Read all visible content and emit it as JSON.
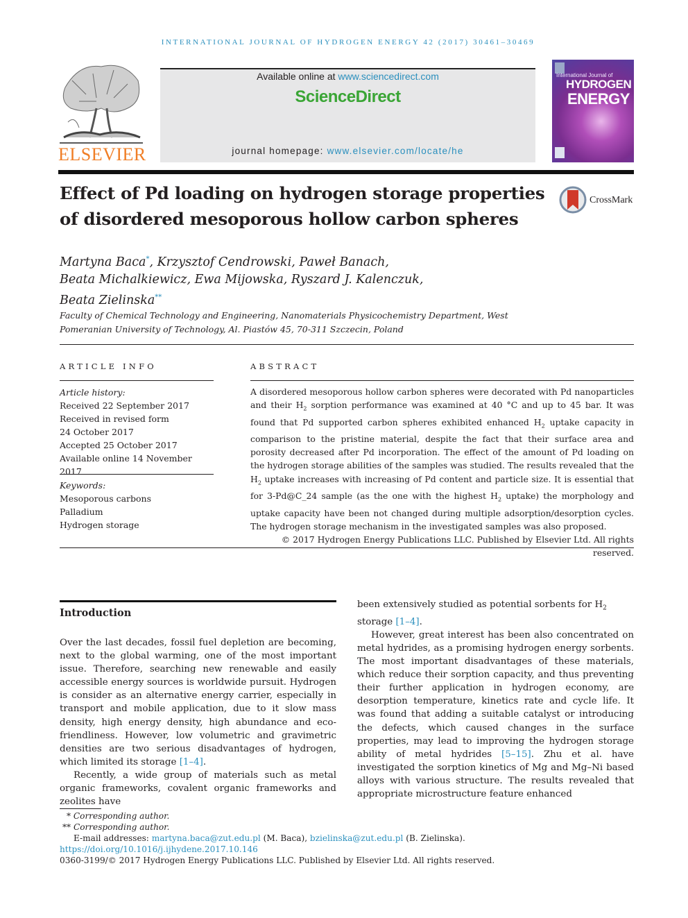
{
  "journal": {
    "running_head": "INTERNATIONAL JOURNAL OF HYDROGEN ENERGY 42 (2017) 30461–30469",
    "publisher_logo": "ELSEVIER",
    "available_prefix": "Available online at ",
    "available_link": "www.sciencedirect.com",
    "brand": "ScienceDirect",
    "homepage_prefix": "journal homepage: ",
    "homepage_link": "www.elsevier.com/locate/he",
    "cover": {
      "line1": "International Journal of",
      "line2": "HYDROGEN",
      "line3": "ENERGY"
    }
  },
  "article": {
    "title": "Effect of Pd loading on hydrogen storage properties of disordered mesoporous hollow carbon spheres",
    "crossmark_label": "CrossMark",
    "authors_line1_a": "Martyna Baca",
    "authors_line1_sup": "*",
    "authors_line1_b": ", Krzysztof Cendrowski, Paweł Banach,",
    "authors_line2": "Beata Michalkiewicz, Ewa Mijowska, Ryszard J. Kalenczuk,",
    "authors_line3_a": "Beata Zielinska",
    "authors_line3_sup": "**",
    "affiliation": "Faculty of Chemical Technology and Engineering, Nanomaterials Physicochemistry Department, West Pomeranian University of Technology, Al. Piastów 45, 70-311 Szczecin, Poland"
  },
  "article_info": {
    "heading": "ARTICLE INFO",
    "history_label": "Article history:",
    "history": [
      "Received 22 September 2017",
      "Received in revised form",
      "24 October 2017",
      "Accepted 25 October 2017",
      "Available online 14 November 2017"
    ],
    "keywords_label": "Keywords:",
    "keywords": [
      "Mesoporous carbons",
      "Palladium",
      "Hydrogen storage"
    ]
  },
  "abstract": {
    "heading": "ABSTRACT",
    "p1": "A disordered mesoporous hollow carbon spheres were decorated with Pd nanoparticles and their H",
    "p2": " sorption performance was examined at 40 °C and up to 45 bar. It was found that Pd supported carbon spheres exhibited enhanced H",
    "p3": " uptake capacity in comparison to the pristine material, despite the fact that their surface area and porosity decreased after Pd incorporation. The effect of the amount of Pd loading on the hydrogen storage abilities of the samples was studied. The results revealed that the H",
    "p4": " uptake increases with increasing of Pd content and particle size. It is essential that for 3-Pd@C_24 sample (as the one with the highest H",
    "p5": " uptake) the morphology and uptake capacity have been not changed during multiple adsorption/desorption cycles. The hydrogen storage mechanism in the investigated samples was also proposed.",
    "sub": "2",
    "copyright": "© 2017 Hydrogen Energy Publications LLC. Published by Elsevier Ltd. All rights reserved."
  },
  "body": {
    "intro_heading": "Introduction",
    "left_p1_a": "Over the last decades, fossil fuel depletion are becoming, next to the global warming, one of the most important issue. Therefore, searching new renewable and easily accessible energy sources is worldwide pursuit. Hydrogen is consider as an alternative energy carrier, especially in transport and mobile application, due to it slow mass density, high energy density, high abundance and eco-friendliness. However, low volumetric and gravimetric densities are two serious disadvantages of hydrogen, which limited its storage ",
    "left_p1_ref": "[1–4]",
    "left_p2": "Recently, a wide group of materials such as metal organic frameworks, covalent organic frameworks and zeolites have",
    "right_p1_a": "been extensively studied as potential sorbents for H",
    "right_p1_b": " storage ",
    "right_p1_ref": "[1–4]",
    "right_p2_a": "However, great interest has been also concentrated on metal hydrides, as a promising hydrogen energy sorbents. The most important disadvantages of these materials, which reduce their sorption capacity, and thus preventing their further application in hydrogen economy, are desorption temperature, kinetics rate and cycle life. It was found that adding a suitable catalyst or introducing the defects, which caused changes in the surface properties, may lead to improving the hydrogen storage ability of metal hydrides ",
    "right_p2_ref": "[5–15]",
    "right_p2_b": ". Zhu et al. have investigated the sorption kinetics of Mg and Mg–Ni based alloys with various structure. The results revealed that appropriate microstructure feature enhanced"
  },
  "footnotes": {
    "fn1_mark": "*",
    "fn1": "Corresponding author.",
    "fn2_mark": "**",
    "fn2": "Corresponding author.",
    "email_label": "E-mail addresses: ",
    "email1": "martyna.baca@zut.edu.pl",
    "email1_name": " (M. Baca), ",
    "email2": "bzielinska@zut.edu.pl",
    "email2_name": " (B. Zielinska).",
    "doi": "https://doi.org/10.1016/j.ijhydene.2017.10.146",
    "issn_copyright": "0360-3199/© 2017 Hydrogen Energy Publications LLC. Published by Elsevier Ltd. All rights reserved."
  }
}
